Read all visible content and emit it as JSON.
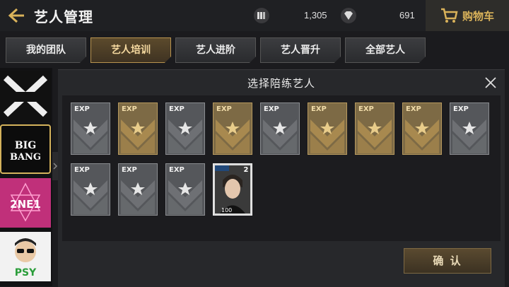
{
  "header": {
    "title": "艺人管理",
    "currency1": {
      "icon": "album-stack-icon",
      "value": "1,305"
    },
    "currency2": {
      "icon": "diamond-icon",
      "value": "691"
    },
    "cart_label": "购物车"
  },
  "tabs": [
    {
      "label": "我的团队",
      "active": false
    },
    {
      "label": "艺人培训",
      "active": true
    },
    {
      "label": "艺人进阶",
      "active": false
    },
    {
      "label": "艺人晋升",
      "active": false
    },
    {
      "label": "全部艺人",
      "active": false
    }
  ],
  "sidebar": {
    "labels": [
      "BIG",
      "BANG",
      "2NE1",
      "PSY"
    ]
  },
  "modal": {
    "title": "选择陪练艺人",
    "confirm_label": "确 认",
    "cards": [
      {
        "type": "exp",
        "tier": "silver",
        "label": "EXP"
      },
      {
        "type": "exp",
        "tier": "gold",
        "label": "EXP"
      },
      {
        "type": "exp",
        "tier": "silver",
        "label": "EXP"
      },
      {
        "type": "exp",
        "tier": "gold",
        "label": "EXP"
      },
      {
        "type": "exp",
        "tier": "silver",
        "label": "EXP"
      },
      {
        "type": "exp",
        "tier": "gold",
        "label": "EXP"
      },
      {
        "type": "exp",
        "tier": "gold",
        "label": "EXP"
      },
      {
        "type": "exp",
        "tier": "gold",
        "label": "EXP"
      },
      {
        "type": "exp",
        "tier": "silver",
        "label": "EXP"
      },
      {
        "type": "exp",
        "tier": "silver",
        "label": "EXP"
      },
      {
        "type": "exp",
        "tier": "silver",
        "label": "EXP"
      },
      {
        "type": "exp",
        "tier": "silver",
        "label": "EXP"
      },
      {
        "type": "artist",
        "level": "2",
        "power": "100"
      }
    ]
  },
  "colors": {
    "accent": "#d9b25a",
    "gold": "#a8894f",
    "silver": "#6b6d71"
  }
}
